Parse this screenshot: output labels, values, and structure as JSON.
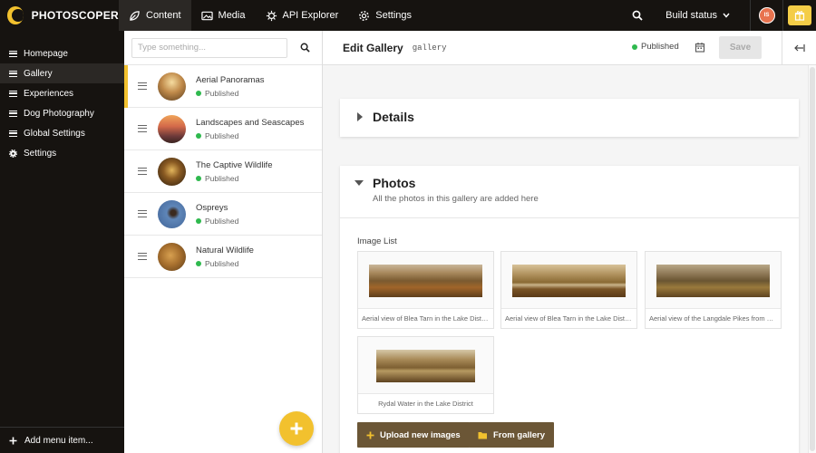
{
  "brand": {
    "name": "PHOTOSCOPER"
  },
  "topnav": [
    {
      "label": "Content",
      "icon": "leaf-icon"
    },
    {
      "label": "Media",
      "icon": "image-icon"
    },
    {
      "label": "API Explorer",
      "icon": "puzzle-icon"
    },
    {
      "label": "Settings",
      "icon": "gear-icon"
    }
  ],
  "topbar": {
    "build_status": "Build status",
    "avatar_initials": "IS"
  },
  "sidebar": {
    "items": [
      {
        "label": "Homepage"
      },
      {
        "label": "Gallery"
      },
      {
        "label": "Experiences"
      },
      {
        "label": "Dog Photography"
      },
      {
        "label": "Global Settings"
      },
      {
        "label": "Settings"
      }
    ],
    "add_item": "Add menu item..."
  },
  "list": {
    "search_placeholder": "Type something...",
    "items": [
      {
        "title": "Aerial Panoramas",
        "status": "Published"
      },
      {
        "title": "Landscapes and Seascapes",
        "status": "Published"
      },
      {
        "title": "The Captive Wildlife",
        "status": "Published"
      },
      {
        "title": "Ospreys",
        "status": "Published"
      },
      {
        "title": "Natural Wildlife",
        "status": "Published"
      }
    ]
  },
  "editor": {
    "title": "Edit Gallery",
    "alias": "gallery",
    "status": "Published",
    "save_label": "Save",
    "details_title": "Details",
    "photos_title": "Photos",
    "photos_subtitle": "All the photos in this gallery are added here",
    "image_list_label": "Image List",
    "images": [
      {
        "caption": "Aerial view of Blea Tarn in the Lake District"
      },
      {
        "caption": "Aerial view of Blea Tarn in the Lake District"
      },
      {
        "caption": "Aerial view of the Langdale Pikes from above"
      },
      {
        "caption": "Rydal Water in the Lake District"
      }
    ],
    "upload_label": "Upload new images",
    "from_gallery_label": "From gallery"
  },
  "colors": {
    "accent": "#f2c12e",
    "sidebar_bg": "#161310",
    "published": "#2fb94e",
    "button_brown": "#6b5636"
  }
}
